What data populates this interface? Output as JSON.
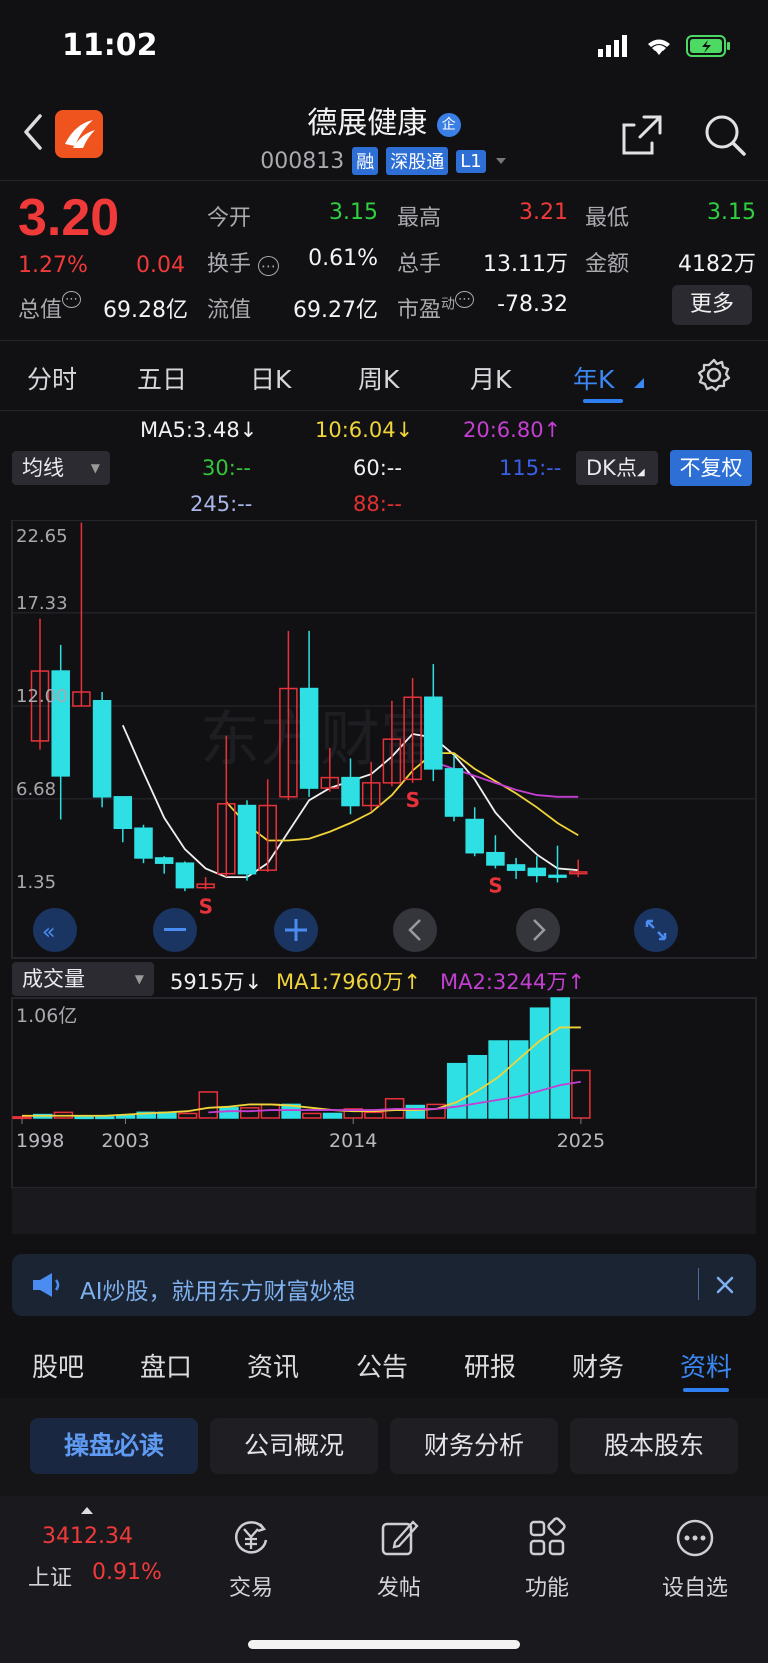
{
  "status": {
    "time": "11:02"
  },
  "header": {
    "name": "德展健康",
    "name_badge": "企",
    "code": "000813",
    "tags": [
      "融",
      "深股通",
      "L1"
    ]
  },
  "quote": {
    "price": "3.20",
    "pct_change": "1.27%",
    "change": "0.04",
    "market_cap_label": "总值",
    "market_cap": "69.28亿",
    "fields": [
      {
        "label": "今开",
        "value": "3.15",
        "color": "green"
      },
      {
        "label": "最高",
        "value": "3.21",
        "color": "red"
      },
      {
        "label": "最低",
        "value": "3.15",
        "color": "green"
      },
      {
        "label": "换手",
        "value": "0.61%",
        "color": "white"
      },
      {
        "label": "总手",
        "value": "13.11万",
        "color": "white"
      },
      {
        "label": "金额",
        "value": "4182万",
        "color": "white"
      },
      {
        "label": "流值",
        "value": "69.27亿",
        "color": "white"
      },
      {
        "label": "市盈",
        "value": "-78.32",
        "color": "white"
      }
    ],
    "pe_superscript": "动",
    "more_label": "更多"
  },
  "period_tabs": [
    "分时",
    "五日",
    "日K",
    "周K",
    "月K",
    "年K"
  ],
  "active_period": "年K",
  "ma_legend": {
    "dropdown": "均线",
    "items": [
      {
        "text": "MA5:3.48↓",
        "color": "#f0f0f0"
      },
      {
        "text": "10:6.04↓",
        "color": "#f0d43a"
      },
      {
        "text": "20:6.80↑",
        "color": "#c43fd1"
      },
      {
        "text": "30:--",
        "color": "#35c53b"
      },
      {
        "text": "60:--",
        "color": "#f0f0f0"
      },
      {
        "text": "115:--",
        "color": "#3b5ee8"
      },
      {
        "text": "245:--",
        "color": "#a9b6e8"
      },
      {
        "text": "88:--",
        "color": "#e13232"
      }
    ],
    "dk_button": "DK点",
    "adjust_button": "不复权"
  },
  "chart_data": {
    "type": "candlestick",
    "y_ticks": [
      "22.65",
      "17.33",
      "12.00",
      "6.68",
      "1.35"
    ],
    "ylim": [
      1.35,
      22.65
    ],
    "x_ticks": [
      "1998",
      "2003",
      "2014",
      "2025"
    ],
    "candles": [
      {
        "o": 10.0,
        "c": 14.0,
        "h": 17.0,
        "l": 9.5
      },
      {
        "o": 14.0,
        "c": 8.0,
        "h": 15.5,
        "l": 5.5
      },
      {
        "o": 12.0,
        "c": 12.8,
        "h": 22.5,
        "l": 12.0
      },
      {
        "o": 12.3,
        "c": 6.8,
        "h": 12.8,
        "l": 6.2
      },
      {
        "o": 6.8,
        "c": 5.0,
        "h": 6.8,
        "l": 4.2
      },
      {
        "o": 5.0,
        "c": 3.3,
        "h": 5.2,
        "l": 3.0
      },
      {
        "o": 3.3,
        "c": 3.0,
        "h": 3.4,
        "l": 2.4
      },
      {
        "o": 3.0,
        "c": 1.6,
        "h": 3.1,
        "l": 1.4
      },
      {
        "o": 1.6,
        "c": 1.8,
        "h": 2.2,
        "l": 1.5
      },
      {
        "o": 2.4,
        "c": 6.4,
        "h": 10.3,
        "l": 2.2
      },
      {
        "o": 6.3,
        "c": 2.4,
        "h": 6.6,
        "l": 2.0
      },
      {
        "o": 2.6,
        "c": 6.3,
        "h": 7.8,
        "l": 2.5
      },
      {
        "o": 6.8,
        "c": 13.0,
        "h": 16.3,
        "l": 6.6
      },
      {
        "o": 13.0,
        "c": 7.3,
        "h": 16.3,
        "l": 6.8
      },
      {
        "o": 7.3,
        "c": 7.9,
        "h": 9.6,
        "l": 7.1
      },
      {
        "o": 7.9,
        "c": 6.3,
        "h": 9.0,
        "l": 5.8
      },
      {
        "o": 6.3,
        "c": 7.6,
        "h": 8.8,
        "l": 6.0
      },
      {
        "o": 7.6,
        "c": 10.1,
        "h": 12.3,
        "l": 7.4
      },
      {
        "o": 7.8,
        "c": 12.5,
        "h": 13.6,
        "l": 7.6
      },
      {
        "o": 12.5,
        "c": 8.4,
        "h": 14.4,
        "l": 7.7
      },
      {
        "o": 8.4,
        "c": 5.7,
        "h": 9.2,
        "l": 5.4
      },
      {
        "o": 5.5,
        "c": 3.6,
        "h": 6.2,
        "l": 3.4
      },
      {
        "o": 3.6,
        "c": 2.9,
        "h": 4.6,
        "l": 2.7
      },
      {
        "o": 2.9,
        "c": 2.6,
        "h": 3.3,
        "l": 2.1
      },
      {
        "o": 2.7,
        "c": 2.3,
        "h": 3.4,
        "l": 1.9
      },
      {
        "o": 2.3,
        "c": 2.2,
        "h": 4.0,
        "l": 1.9
      },
      {
        "o": 2.4,
        "c": 2.5,
        "h": 3.2,
        "l": 2.2
      }
    ],
    "ma5": [
      null,
      null,
      null,
      null,
      10.9,
      8.2,
      5.6,
      3.8,
      2.7,
      2.2,
      2.2,
      3.0,
      4.8,
      6.6,
      7.3,
      7.7,
      8.1,
      9.1,
      10.4,
      10.2,
      9.2,
      7.8,
      5.9,
      4.6,
      3.5,
      2.7,
      2.6
    ],
    "ma10": [
      null,
      null,
      null,
      null,
      null,
      null,
      null,
      null,
      null,
      6.5,
      5.2,
      4.3,
      4.3,
      4.4,
      4.8,
      5.3,
      5.9,
      6.9,
      8.3,
      9.3,
      9.3,
      8.4,
      7.7,
      7.0,
      6.2,
      5.3,
      4.6
    ],
    "ma20": [
      null,
      null,
      null,
      null,
      null,
      null,
      null,
      null,
      null,
      null,
      null,
      null,
      null,
      null,
      null,
      null,
      null,
      null,
      null,
      8.8,
      8.4,
      8.0,
      7.6,
      7.2,
      6.9,
      6.8,
      6.8
    ],
    "markers": [
      {
        "label": "S",
        "index": 8
      },
      {
        "label": "S",
        "index": 18
      },
      {
        "label": "S",
        "index": 22
      }
    ],
    "volume": {
      "label": "成交量",
      "current": "5915万↓",
      "ma1_label": "MA1:7960万↑",
      "ma2_label": "MA2:3244万↑",
      "max_label": "1.06亿",
      "ylim": [
        0,
        1.06
      ],
      "bars": [
        {
          "v": 0.01,
          "up": true
        },
        {
          "v": 0.03,
          "up": false
        },
        {
          "v": 0.05,
          "up": true
        },
        {
          "v": 0.01,
          "up": false
        },
        {
          "v": 0.01,
          "up": false
        },
        {
          "v": 0.02,
          "up": false
        },
        {
          "v": 0.05,
          "up": false
        },
        {
          "v": 0.05,
          "up": false
        },
        {
          "v": 0.04,
          "up": true
        },
        {
          "v": 0.23,
          "up": true
        },
        {
          "v": 0.09,
          "up": false
        },
        {
          "v": 0.09,
          "up": true
        },
        {
          "v": 0.12,
          "up": true
        },
        {
          "v": 0.12,
          "up": false
        },
        {
          "v": 0.04,
          "up": true
        },
        {
          "v": 0.04,
          "up": false
        },
        {
          "v": 0.08,
          "up": true
        },
        {
          "v": 0.05,
          "up": true
        },
        {
          "v": 0.17,
          "up": true
        },
        {
          "v": 0.11,
          "up": false
        },
        {
          "v": 0.12,
          "up": true
        },
        {
          "v": 0.48,
          "up": false
        },
        {
          "v": 0.55,
          "up": false
        },
        {
          "v": 0.68,
          "up": false
        },
        {
          "v": 0.68,
          "up": false
        },
        {
          "v": 0.97,
          "up": false
        },
        {
          "v": 1.06,
          "up": false
        },
        {
          "v": 0.42,
          "up": true
        }
      ],
      "ma1": [
        0.02,
        0.02,
        0.02,
        0.02,
        0.02,
        0.03,
        0.04,
        0.05,
        0.06,
        0.09,
        0.1,
        0.12,
        0.12,
        0.11,
        0.09,
        0.07,
        0.06,
        0.06,
        0.07,
        0.07,
        0.08,
        0.14,
        0.24,
        0.36,
        0.52,
        0.68,
        0.8,
        0.8
      ],
      "ma2": [
        null,
        null,
        null,
        null,
        null,
        null,
        null,
        null,
        null,
        0.05,
        0.06,
        0.06,
        0.07,
        0.07,
        0.07,
        0.07,
        0.07,
        0.07,
        0.08,
        0.08,
        0.08,
        0.1,
        0.13,
        0.16,
        0.19,
        0.24,
        0.29,
        0.32
      ]
    }
  },
  "ad": {
    "text": "AI炒股，就用东方财富妙想"
  },
  "bottom_tabs": [
    "股吧",
    "盘口",
    "资讯",
    "公告",
    "研报",
    "财务",
    "资料"
  ],
  "active_bottom_tab": "资料",
  "chips": [
    "操盘必读",
    "公司概况",
    "财务分析",
    "股本股东"
  ],
  "tabbar": {
    "index_value": "3412.34",
    "index_name": "上证",
    "index_pct": "0.91%",
    "items": [
      "交易",
      "发帖",
      "功能",
      "设自选"
    ]
  }
}
